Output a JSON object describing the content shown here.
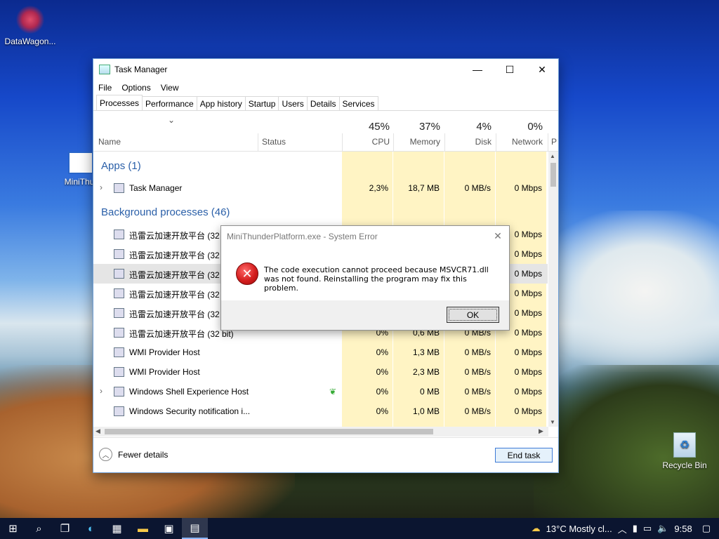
{
  "desktop": {
    "icons": [
      {
        "label": "DataWagon..."
      },
      {
        "label": "MiniThur"
      },
      {
        "label": "Recycle Bin"
      }
    ]
  },
  "task_manager": {
    "title": "Task Manager",
    "menu": [
      "File",
      "Options",
      "View"
    ],
    "tabs": [
      "Processes",
      "Performance",
      "App history",
      "Startup",
      "Users",
      "Details",
      "Services"
    ],
    "columns": {
      "name": "Name",
      "status": "Status",
      "cpu_pct": "45%",
      "cpu": "CPU",
      "mem_pct": "37%",
      "mem": "Memory",
      "disk_pct": "4%",
      "disk": "Disk",
      "net_pct": "0%",
      "net": "Network",
      "power": "P"
    },
    "groups": {
      "apps": "Apps (1)",
      "background": "Background processes (46)"
    },
    "rows": [
      {
        "name": "Task Manager",
        "cpu": "2,3%",
        "mem": "18,7 MB",
        "disk": "0 MB/s",
        "net": "0 Mbps"
      },
      {
        "name": "迅雷云加速开放平台 (32",
        "cpu": "",
        "mem": "",
        "disk": "",
        "net": "0 Mbps"
      },
      {
        "name": "迅雷云加速开放平台 (32",
        "cpu": "",
        "mem": "",
        "disk": "",
        "net": "0 Mbps"
      },
      {
        "name": "迅雷云加速开放平台 (32",
        "cpu": "",
        "mem": "",
        "disk": "",
        "net": "0 Mbps"
      },
      {
        "name": "迅雷云加速开放平台 (32",
        "cpu": "",
        "mem": "",
        "disk": "",
        "net": "0 Mbps"
      },
      {
        "name": "迅雷云加速开放平台 (32",
        "cpu": "",
        "mem": "",
        "disk": "",
        "net": "0 Mbps"
      },
      {
        "name": "迅雷云加速开放平台 (32 bit)",
        "cpu": "0%",
        "mem": "0,6 MB",
        "disk": "0 MB/s",
        "net": "0 Mbps"
      },
      {
        "name": "WMI Provider Host",
        "cpu": "0%",
        "mem": "1,3 MB",
        "disk": "0 MB/s",
        "net": "0 Mbps"
      },
      {
        "name": "WMI Provider Host",
        "cpu": "0%",
        "mem": "2,3 MB",
        "disk": "0 MB/s",
        "net": "0 Mbps"
      },
      {
        "name": "Windows Shell Experience Host",
        "cpu": "0%",
        "mem": "0 MB",
        "disk": "0 MB/s",
        "net": "0 Mbps"
      },
      {
        "name": "Windows Security notification i...",
        "cpu": "0%",
        "mem": "1,0 MB",
        "disk": "0 MB/s",
        "net": "0 Mbps"
      }
    ],
    "footer": {
      "fewer_details": "Fewer details",
      "end_task": "End task"
    }
  },
  "error_dialog": {
    "title": "MiniThunderPlatform.exe - System Error",
    "message": "The code execution cannot proceed because MSVCR71.dll was not found. Reinstalling the program may fix this problem.",
    "ok": "OK"
  },
  "taskbar": {
    "weather": "13°C  Mostly cl...",
    "time": "9:58"
  }
}
